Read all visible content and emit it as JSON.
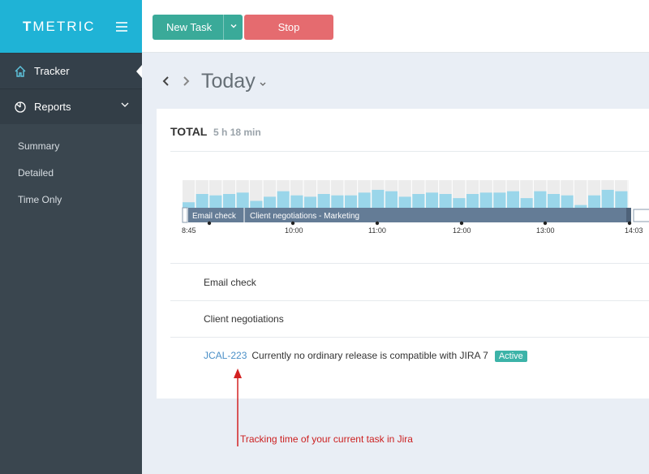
{
  "brand": {
    "prefix": "T",
    "rest": "METRIC"
  },
  "sidebar": {
    "items": [
      {
        "label": "Tracker",
        "icon": "home-icon"
      },
      {
        "label": "Reports",
        "icon": "pie-chart-icon"
      }
    ],
    "sub_items": [
      "Summary",
      "Detailed",
      "Time Only"
    ]
  },
  "toolbar": {
    "new_task_label": "New Task",
    "stop_label": "Stop"
  },
  "date_nav": {
    "label": "Today"
  },
  "summary": {
    "total_label": "TOTAL",
    "total_value": "5 h 18 min"
  },
  "timeline": {
    "start_label": "8:45",
    "end_label": "14:03",
    "ticks": [
      "10:00",
      "11:00",
      "12:00",
      "13:00"
    ],
    "segments": [
      "Email check",
      "Client negotiations - Marketing"
    ],
    "activity_levels": [
      0.2,
      0.5,
      0.45,
      0.5,
      0.55,
      0.25,
      0.4,
      0.6,
      0.45,
      0.4,
      0.5,
      0.45,
      0.45,
      0.55,
      0.65,
      0.6,
      0.4,
      0.5,
      0.55,
      0.5,
      0.35,
      0.5,
      0.55,
      0.55,
      0.6,
      0.35,
      0.6,
      0.5,
      0.45,
      0.1,
      0.45,
      0.65,
      0.6
    ]
  },
  "tasks": [
    {
      "name": "Email check"
    },
    {
      "name": "Client negotiations"
    }
  ],
  "active_task": {
    "key": "JCAL-223",
    "description": "Currently no ordinary release is compatible with JIRA 7",
    "badge": "Active"
  },
  "annotation": {
    "text": "Tracking time of your current task in Jira"
  },
  "colors": {
    "brand": "#1fb3d6",
    "new_task": "#3aaa99",
    "stop": "#e56b6f",
    "sidebar": "#3a464f",
    "timeline_bar": "#647c96",
    "activity": "#9ad6ea"
  }
}
